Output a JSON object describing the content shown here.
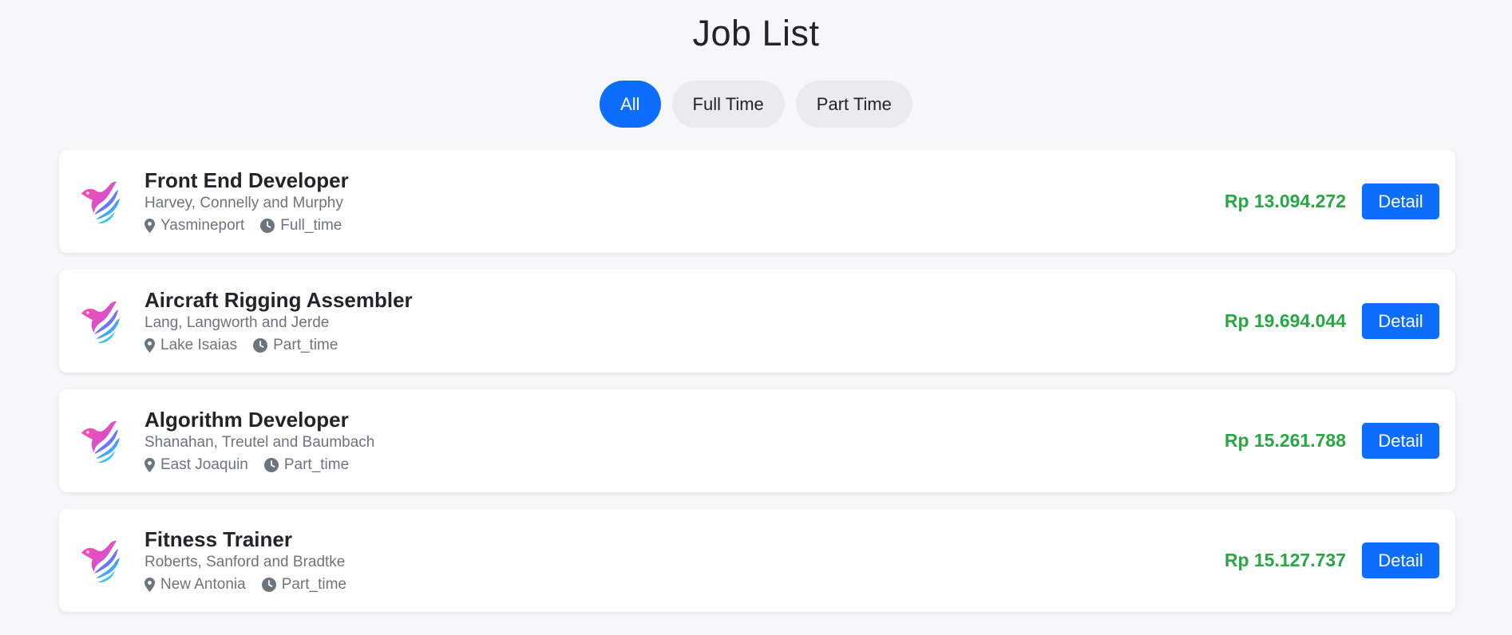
{
  "page": {
    "title": "Job List"
  },
  "filters": [
    {
      "label": "All",
      "active": true
    },
    {
      "label": "Full Time",
      "active": false
    },
    {
      "label": "Part Time",
      "active": false
    }
  ],
  "jobs": [
    {
      "title": "Front End Developer",
      "company": "Harvey, Connelly and Murphy",
      "location": "Yasmineport",
      "type": "Full_time",
      "salary": "Rp 13.094.272",
      "detail_label": "Detail"
    },
    {
      "title": "Aircraft Rigging Assembler",
      "company": "Lang, Langworth and Jerde",
      "location": "Lake Isaias",
      "type": "Part_time",
      "salary": "Rp 19.694.044",
      "detail_label": "Detail"
    },
    {
      "title": "Algorithm Developer",
      "company": "Shanahan, Treutel and Baumbach",
      "location": "East Joaquin",
      "type": "Part_time",
      "salary": "Rp 15.261.788",
      "detail_label": "Detail"
    },
    {
      "title": "Fitness Trainer",
      "company": "Roberts, Sanford and Bradtke",
      "location": "New Antonia",
      "type": "Part_time",
      "salary": "Rp 15.127.737",
      "detail_label": "Detail"
    }
  ],
  "colors": {
    "accent": "#0d6efd",
    "salary": "#28a745",
    "muted": "#6c757d",
    "background": "#f6f7f9"
  },
  "icons": {
    "location": "map-pin-icon",
    "job_type": "clock-icon",
    "company_logo": "bird-logo-icon"
  }
}
